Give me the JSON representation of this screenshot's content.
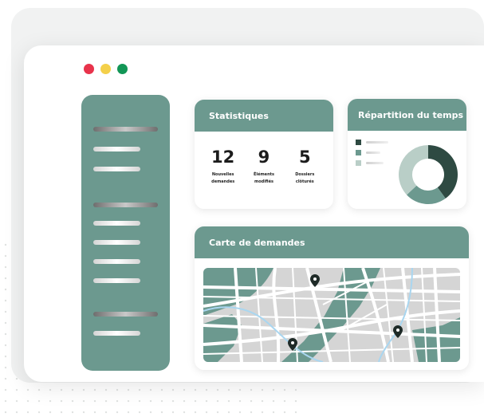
{
  "colors": {
    "accent": "#6c998f",
    "dark_green": "#2e4a42",
    "mid_green": "#6c998f",
    "light_green": "#b9cec7",
    "traffic_red": "#e8334b",
    "traffic_yellow": "#f4d04a",
    "traffic_green": "#129656",
    "map_block": "#d5d5d5",
    "map_road": "#ffffff",
    "map_river": "#a9d6f0"
  },
  "stats": {
    "title": "Statistiques",
    "items": [
      {
        "number": "12",
        "label_line1": "Nouvelles",
        "label_line2": "demandes"
      },
      {
        "number": "9",
        "label_line1": "Éléments",
        "label_line2": "modifiés"
      },
      {
        "number": "5",
        "label_line1": "Dossiers",
        "label_line2": "clôturés"
      }
    ]
  },
  "time": {
    "title": "Répartition du temps",
    "slices": [
      {
        "color": "#2e4a42",
        "value": 40
      },
      {
        "color": "#6c998f",
        "value": 23
      },
      {
        "color": "#b9cec7",
        "value": 37
      }
    ]
  },
  "map": {
    "title": "Carte de demandes",
    "pin_icon": "map-pin-icon"
  }
}
